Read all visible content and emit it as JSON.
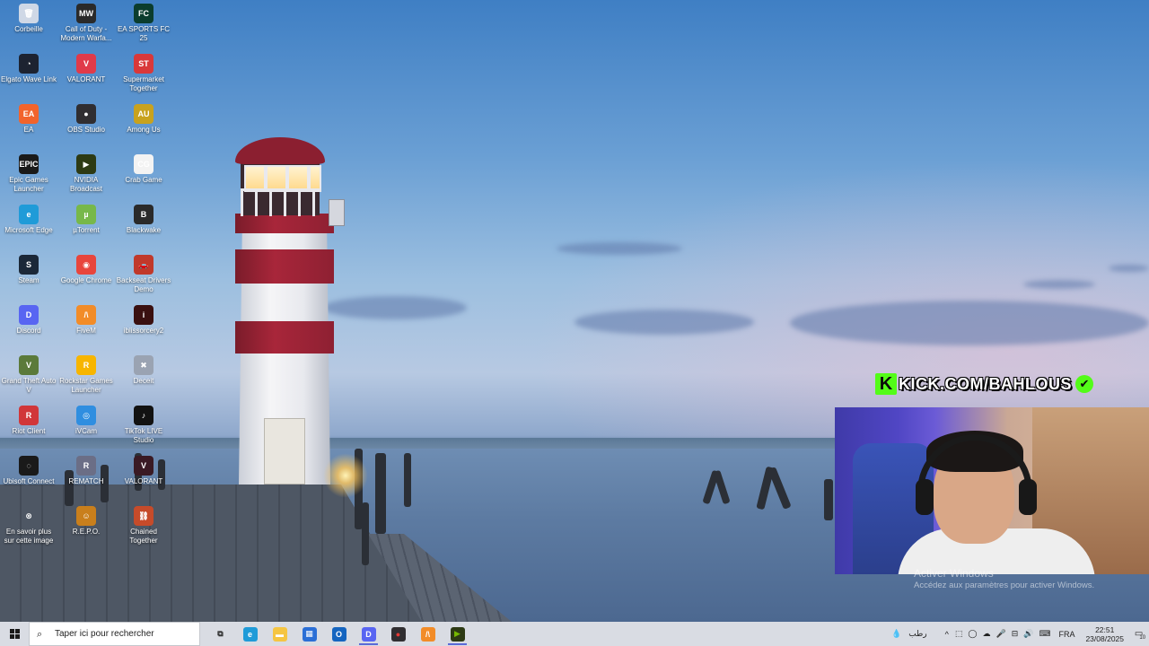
{
  "desktop": {
    "icons": [
      {
        "label": "Corbeille",
        "icon": "recycle-bin-icon",
        "color": "#cfd8e6",
        "glyph": "🗑"
      },
      {
        "label": "Call of Duty - Modern Warfa...",
        "icon": "call-of-duty-icon",
        "color": "#2a2a2a",
        "glyph": "MW"
      },
      {
        "label": "EA SPORTS FC 25",
        "icon": "ea-sports-fc-icon",
        "color": "#0b3d2e",
        "glyph": "FC"
      },
      {
        "label": "Elgato Wave Link",
        "icon": "elgato-wave-link-icon",
        "color": "#1d2331",
        "glyph": "◔"
      },
      {
        "label": "VALORANT",
        "icon": "valorant-icon",
        "color": "#e03a4a",
        "glyph": "V"
      },
      {
        "label": "Supermarket Together",
        "icon": "supermarket-together-icon",
        "color": "#d9383a",
        "glyph": "ST"
      },
      {
        "label": "EA",
        "icon": "ea-app-icon",
        "color": "#f2642c",
        "glyph": "EA"
      },
      {
        "label": "OBS Studio",
        "icon": "obs-studio-icon",
        "color": "#302e31",
        "glyph": "●"
      },
      {
        "label": "Among Us",
        "icon": "among-us-icon",
        "color": "#c8a21e",
        "glyph": "AU"
      },
      {
        "label": "Epic Games Launcher",
        "icon": "epic-games-icon",
        "color": "#1a1a1a",
        "glyph": "EPIC"
      },
      {
        "label": "NVIDIA Broadcast",
        "icon": "nvidia-broadcast-icon",
        "color": "#2d3a14",
        "glyph": "▶"
      },
      {
        "label": "Crab Game",
        "icon": "crab-game-icon",
        "color": "#f3f3f3",
        "glyph": "CG"
      },
      {
        "label": "Microsoft Edge",
        "icon": "microsoft-edge-icon",
        "color": "#1f9bd8",
        "glyph": "e"
      },
      {
        "label": "µTorrent",
        "icon": "utorrent-icon",
        "color": "#77b84a",
        "glyph": "µ"
      },
      {
        "label": "Blackwake",
        "icon": "blackwake-icon",
        "color": "#2a2a2a",
        "glyph": "B"
      },
      {
        "label": "Steam",
        "icon": "steam-icon",
        "color": "#1b2838",
        "glyph": "S"
      },
      {
        "label": "Google Chrome",
        "icon": "google-chrome-icon",
        "color": "#e8453c",
        "glyph": "◉"
      },
      {
        "label": "Backseat Drivers Demo",
        "icon": "backseat-drivers-icon",
        "color": "#c0392b",
        "glyph": "🚗"
      },
      {
        "label": "Discord",
        "icon": "discord-icon",
        "color": "#5865f2",
        "glyph": "D"
      },
      {
        "label": "FiveM",
        "icon": "fivem-icon",
        "color": "#f28c28",
        "glyph": "/\\"
      },
      {
        "label": "iblissorcery2",
        "icon": "iblissorcery-icon",
        "color": "#3a1010",
        "glyph": "i"
      },
      {
        "label": "Grand Theft Auto V",
        "icon": "gta-v-icon",
        "color": "#5b7a3a",
        "glyph": "V"
      },
      {
        "label": "Rockstar Games Launcher",
        "icon": "rockstar-launcher-icon",
        "color": "#f7b500",
        "glyph": "R"
      },
      {
        "label": "Deceit",
        "icon": "deceit-icon",
        "color": "#9aa3b2",
        "glyph": "✖"
      },
      {
        "label": "Riot Client",
        "icon": "riot-client-icon",
        "color": "#d13639",
        "glyph": "R"
      },
      {
        "label": "iVCam",
        "icon": "ivcam-icon",
        "color": "#2f8ee0",
        "glyph": "◎"
      },
      {
        "label": "TikTok LIVE Studio",
        "icon": "tiktok-live-studio-icon",
        "color": "#121212",
        "glyph": "♪"
      },
      {
        "label": "Ubisoft Connect",
        "icon": "ubisoft-connect-icon",
        "color": "#1a1a1a",
        "glyph": "◌"
      },
      {
        "label": "REMATCH",
        "icon": "rematch-icon",
        "color": "#6b6e86",
        "glyph": "R"
      },
      {
        "label": "VALORANT",
        "icon": "valorant-shortcut-icon",
        "color": "#3a1a24",
        "glyph": "V"
      },
      {
        "label": "En savoir plus sur cette image",
        "icon": "info-camera-icon",
        "color": "transparent",
        "glyph": "⊗"
      },
      {
        "label": "R.E.P.O.",
        "icon": "repo-game-icon",
        "color": "#c97f1c",
        "glyph": "☺"
      },
      {
        "label": "Chained Together",
        "icon": "chained-together-icon",
        "color": "#c64b2a",
        "glyph": "⛓"
      }
    ]
  },
  "overlay": {
    "kick_logo": "K",
    "kick_url": "KICK.COM/BAHLOUS",
    "verified": "✔"
  },
  "activation": {
    "title": "Activer Windows",
    "subtitle": "Accédez aux paramètres pour activer Windows."
  },
  "taskbar": {
    "search_placeholder": "Taper ici pour rechercher",
    "apps": [
      {
        "name": "task-view",
        "glyph": "⧉",
        "color": "transparent",
        "text_color": "#222"
      },
      {
        "name": "microsoft-edge",
        "glyph": "e",
        "color": "#1f9bd8",
        "text_color": "#fff"
      },
      {
        "name": "file-explorer",
        "glyph": "▬",
        "color": "#f5c542",
        "text_color": "#fff"
      },
      {
        "name": "microsoft-store",
        "glyph": "▦",
        "color": "#2b6fd6",
        "text_color": "#fff"
      },
      {
        "name": "outlook",
        "glyph": "O",
        "color": "#1565c0",
        "text_color": "#fff"
      },
      {
        "name": "discord",
        "glyph": "D",
        "color": "#5865f2",
        "text_color": "#fff"
      },
      {
        "name": "obs-studio",
        "glyph": "●",
        "color": "#302e31",
        "text_color": "#e53935"
      },
      {
        "name": "fivem",
        "glyph": "/\\",
        "color": "#f28c28",
        "text_color": "#fff"
      },
      {
        "name": "nvidia-broadcast",
        "glyph": "▶",
        "color": "#2d3a14",
        "text_color": "#76b900"
      }
    ],
    "tray": {
      "weather_icon": "💧",
      "weather_text": "رطب",
      "chevron": "^",
      "icons": [
        "⬚",
        "◯",
        "☁",
        "🎤",
        "⊟",
        "🔊",
        "⌨"
      ],
      "language": "FRA",
      "time": "22:51",
      "date": "23/08/2025",
      "notification_count": "10"
    }
  }
}
